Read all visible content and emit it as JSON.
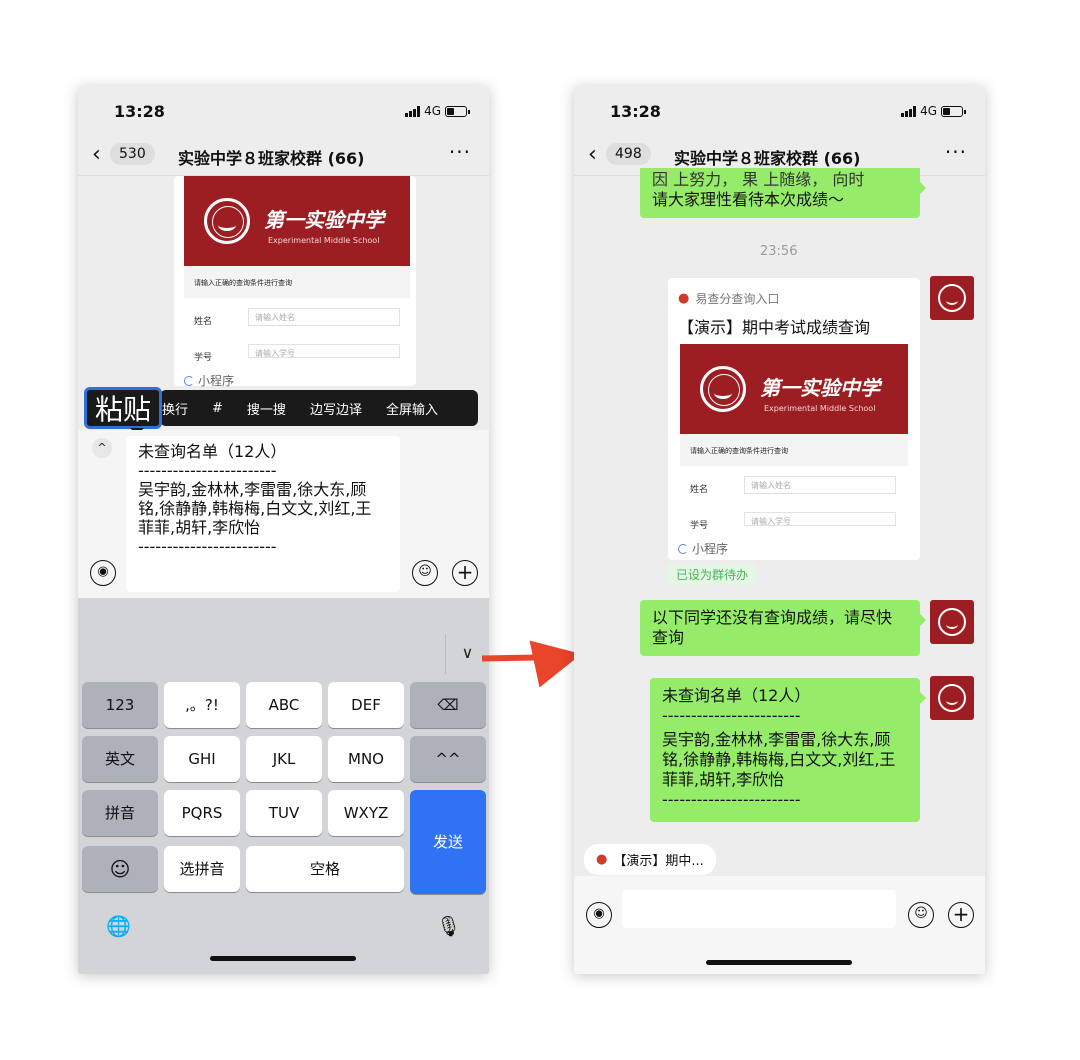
{
  "left": {
    "status": {
      "time": "13:28",
      "network": "4G"
    },
    "nav": {
      "back_count": "530",
      "title": "实验中学８班家校群 (66)",
      "more": "···"
    },
    "card": {
      "school_cn": "第一实验中学",
      "school_en": "Experimental Middle School",
      "hint": "请输入正确的查询条件进行查询",
      "name_label": "姓名",
      "name_placeholder": "请输入姓名",
      "id_label": "学号",
      "id_placeholder": "请输入学号",
      "mini_program": "小程序"
    },
    "paste_menu": {
      "paste": "粘贴",
      "items": [
        "换行",
        "#",
        "搜一搜",
        "边写边译",
        "全屏输入"
      ]
    },
    "input_text": [
      "未查询名单（12人）",
      "------------------------",
      "吴宇韵,金林林,李雷雷,徐大东,顾",
      "铭,徐静静,韩梅梅,白文文,刘红,王",
      "菲菲,胡轩,李欣怡",
      "------------------------"
    ],
    "keyboard": {
      "collapse": "∨",
      "row1": [
        "123",
        ",。?!",
        "ABC",
        "DEF",
        "⌫"
      ],
      "row2": [
        "英文",
        "GHI",
        "JKL",
        "MNO",
        "^^"
      ],
      "row3": [
        "拼音",
        "PQRS",
        "TUV",
        "WXYZ"
      ],
      "send": "发送",
      "row4": [
        "☺",
        "选拼音",
        "空格"
      ],
      "globe": "🌐",
      "mic": "🎙"
    }
  },
  "right": {
    "status": {
      "time": "13:28",
      "network": "4G"
    },
    "nav": {
      "back_count": "498",
      "title": "实验中学８班家校群 (66)",
      "more": "···"
    },
    "messages": {
      "m1": [
        "因 上努力， 果 上随缘， 向时",
        "请大家理性看待本次成绩～"
      ],
      "time": "23:56",
      "card_source": "易查分查询入口",
      "card_title": "【演示】期中考试成绩查询",
      "group_tag": "已设为群待办",
      "m2": [
        "以下同学还没有查询成绩，请尽快",
        "查询"
      ],
      "m3": [
        "未查询名单（12人）",
        "------------------------",
        "吴宇韵,金林林,李雷雷,徐大东,顾",
        "铭,徐静静,韩梅梅,白文文,刘红,王",
        "菲菲,胡轩,李欣怡",
        "------------------------"
      ]
    },
    "card": {
      "school_cn": "第一实验中学",
      "school_en": "Experimental Middle School",
      "hint": "请输入正确的查询条件进行查询",
      "name_label": "姓名",
      "name_placeholder": "请输入姓名",
      "id_label": "学号",
      "id_placeholder": "请输入学号",
      "mini_program": "小程序"
    },
    "quote": "【演示】期中..."
  },
  "colors": {
    "bubble": "#95ec69",
    "brand_red": "#9d1e22",
    "send_blue": "#2f73f4",
    "arrow": "#e8452a"
  }
}
